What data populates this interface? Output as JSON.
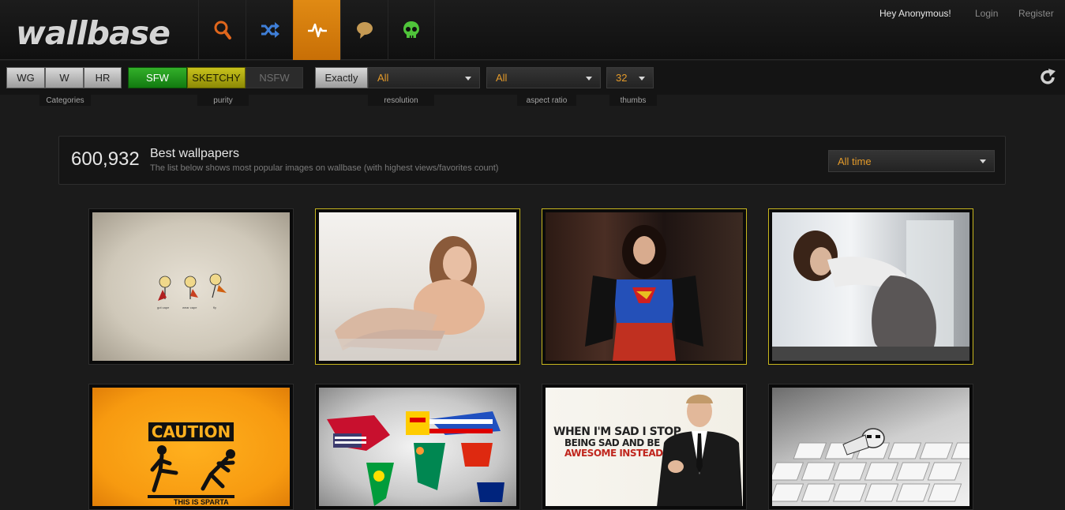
{
  "header": {
    "logo": "wallbase",
    "greeting": "Hey Anonymous!",
    "login": "Login",
    "register": "Register",
    "nav": [
      {
        "icon": "search-icon",
        "color": "#e0661c"
      },
      {
        "icon": "shuffle-icon",
        "color": "#3f7fd8"
      },
      {
        "icon": "pulse-icon",
        "color": "#ffffff",
        "active": true
      },
      {
        "icon": "speech-bubble-icon",
        "color": "#c59a54"
      },
      {
        "icon": "skull-icon",
        "color": "#4fc43a"
      }
    ]
  },
  "toolbar": {
    "categories": [
      "WG",
      "W",
      "HR"
    ],
    "purity": {
      "sfw": "SFW",
      "sketchy": "SKETCHY",
      "nsfw": "NSFW"
    },
    "res_mode": "Exactly",
    "resolution": "All",
    "aspect_ratio": "All",
    "thumbs": "32",
    "labels": {
      "categories": "Categories",
      "purity": "purity",
      "resolution": "resolution",
      "aspect_ratio": "aspect ratio",
      "thumbs": "thumbs"
    }
  },
  "info": {
    "count": "600,932",
    "title": "Best wallpapers",
    "subtitle": "The list below shows most popular images on wallbase (with highest views/favorites count)",
    "time_range": "All time"
  },
  "thumbs": [
    {
      "purity": "sfw",
      "caption_1": "got cape",
      "caption_2": "wear cape",
      "caption_3": "fly"
    },
    {
      "purity": "sketchy"
    },
    {
      "purity": "sketchy"
    },
    {
      "purity": "sketchy"
    },
    {
      "purity": "sfw",
      "caution": "CAUTION",
      "sparta": "THIS IS SPARTA"
    },
    {
      "purity": "sfw"
    },
    {
      "purity": "sfw",
      "quote_1": "WHEN I'M SAD I STOP",
      "quote_2": "BEING SAD AND BE",
      "quote_3": "AWESOME INSTEAD."
    },
    {
      "purity": "sfw"
    }
  ]
}
